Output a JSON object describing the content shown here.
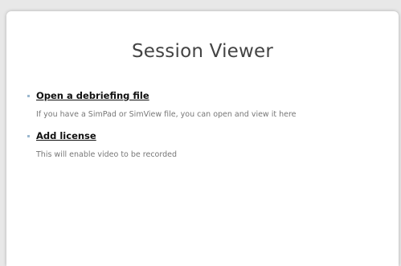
{
  "window": {
    "title": "Session Viewer"
  },
  "actions": [
    {
      "label": "Open a debriefing file",
      "description": "If you have a SimPad or SimView file, you can open and view it here"
    },
    {
      "label": "Add license",
      "description": "This will enable video to be recorded"
    }
  ],
  "colors": {
    "background": "#e8e8e8",
    "panel": "#ffffff",
    "title": "#444444",
    "link": "#111111",
    "description": "#777777",
    "bullet": "#9bb8cf"
  }
}
